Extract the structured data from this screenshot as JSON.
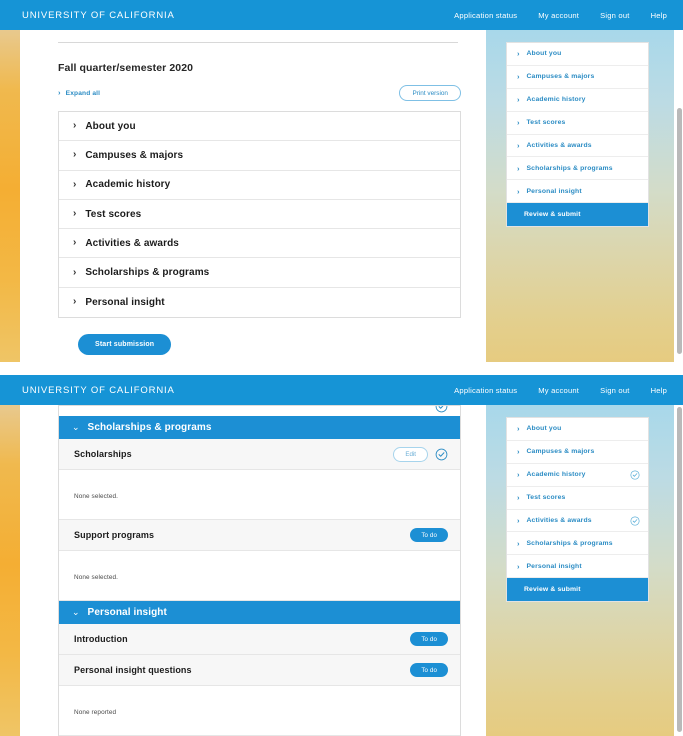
{
  "header": {
    "brand": "UNIVERSITY OF CALIFORNIA",
    "nav": [
      {
        "label": "Application status"
      },
      {
        "label": "My account"
      },
      {
        "label": "Sign out"
      },
      {
        "label": "Help"
      }
    ]
  },
  "top_shot": {
    "term_title": "Fall quarter/semester 2020",
    "expand_all_label": "Expand all",
    "print_label": "Print version",
    "accordion": [
      {
        "label": "About you"
      },
      {
        "label": "Campuses & majors"
      },
      {
        "label": "Academic history"
      },
      {
        "label": "Test scores"
      },
      {
        "label": "Activities & awards"
      },
      {
        "label": "Scholarships & programs"
      },
      {
        "label": "Personal insight"
      }
    ],
    "start_button": "Start submission",
    "sidenav": {
      "items": [
        {
          "label": "About you",
          "complete": false
        },
        {
          "label": "Campuses & majors",
          "complete": false
        },
        {
          "label": "Academic history",
          "complete": false
        },
        {
          "label": "Test scores",
          "complete": false
        },
        {
          "label": "Activities & awards",
          "complete": false
        },
        {
          "label": "Scholarships & programs",
          "complete": false
        },
        {
          "label": "Personal insight",
          "complete": false
        }
      ],
      "review_label": "Review & submit"
    }
  },
  "bottom_shot": {
    "sections": [
      {
        "title": "Scholarships & programs",
        "rows": [
          {
            "label": "Scholarships",
            "action": "Edit",
            "status": "complete",
            "detail": "None selected."
          },
          {
            "label": "Support programs",
            "action": "To do",
            "status": "todo",
            "detail": "None selected."
          }
        ]
      },
      {
        "title": "Personal insight",
        "rows": [
          {
            "label": "Introduction",
            "action": "To do",
            "status": "todo",
            "detail": null
          },
          {
            "label": "Personal insight questions",
            "action": "To do",
            "status": "todo",
            "detail": "None reported"
          }
        ]
      }
    ],
    "sidenav": {
      "items": [
        {
          "label": "About you",
          "complete": false
        },
        {
          "label": "Campuses & majors",
          "complete": false
        },
        {
          "label": "Academic history",
          "complete": true
        },
        {
          "label": "Test scores",
          "complete": false
        },
        {
          "label": "Activities & awards",
          "complete": true
        },
        {
          "label": "Scholarships & programs",
          "complete": false
        },
        {
          "label": "Personal insight",
          "complete": false
        }
      ],
      "review_label": "Review & submit"
    }
  },
  "icons": {
    "chevron_right": "›",
    "chevron_down": "⌄"
  },
  "colors": {
    "header_blue": "#1694d6",
    "accent_blue": "#1c8fd4",
    "link_blue": "#2b8cc4",
    "gold": "#f4ae33"
  }
}
